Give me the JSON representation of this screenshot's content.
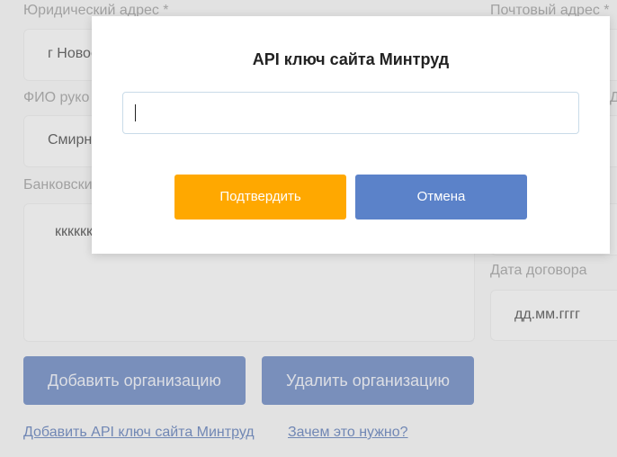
{
  "form": {
    "legal_address_label": "Юридический адрес *",
    "legal_address_value": "г Новос",
    "director_label": "ФИО руко",
    "director_value": "Смирн",
    "bank_label": "Банковски",
    "bank_value": "кккккк",
    "postal_address_label": "Почтовый адрес *",
    "right_partial_label": "Д",
    "contract_date_label": "Дата договора",
    "contract_date_placeholder": "дд.мм.гггг"
  },
  "actions": {
    "add_org_label": "Добавить организацию",
    "delete_org_label": "Удалить организацию",
    "add_api_key_link": "Добавить API ключ сайта Минтруд",
    "why_link": "Зачем это нужно?"
  },
  "modal": {
    "title": "API ключ сайта Минтруд",
    "input_value": "",
    "confirm_label": "Подтвердить",
    "cancel_label": "Отмена"
  },
  "colors": {
    "confirm": "#ffa800",
    "cancel": "#5b82c9",
    "primary_button": "#4a6cb3",
    "link": "#3b5fa8"
  }
}
